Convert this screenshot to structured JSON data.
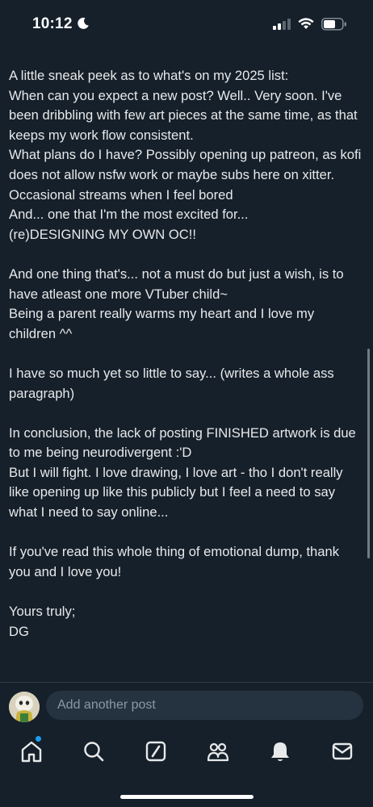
{
  "status_bar": {
    "time": "10:12"
  },
  "post": {
    "paragraphs": [
      "A little sneak peek as to what's on my 2025 list:\nWhen can you expect a new post? Well.. Very soon. I've been dribbling with few art pieces at the same time, as that keeps my work flow consistent.\nWhat plans do I have? Possibly opening up patreon, as kofi does not allow nsfw work or maybe subs here on xitter.\nOccasional streams when I feel bored\nAnd... one that I'm the most excited for...\n(re)DESIGNING MY OWN OC!!",
      "And one thing that's... not a must do but just a wish, is to have atleast one more VTuber child~\nBeing a parent really warms my heart and I love my children ^^",
      "I have so much yet so little to say... (writes a whole ass paragraph)",
      "In conclusion, the lack of posting FINISHED artwork is due to me being neurodivergent :'D\nBut I will fight. I love drawing, I love art - tho I don't really like opening up like this publicly but I feel a need to say what I need to say online...",
      "If you've read this whole thing of emotional dump, thank you and I love you!",
      "Yours truly;\nDG"
    ]
  },
  "reply": {
    "placeholder": "Add another post"
  },
  "nav": {
    "items": [
      {
        "icon": "home-icon"
      },
      {
        "icon": "search-icon"
      },
      {
        "icon": "grok-icon"
      },
      {
        "icon": "communities-icon"
      },
      {
        "icon": "notifications-icon"
      },
      {
        "icon": "messages-icon"
      }
    ]
  },
  "colors": {
    "background": "#16202b",
    "text": "#e7e9ea",
    "accent": "#1d9bf0",
    "input_bg": "#253341",
    "placeholder": "#8b98a5"
  }
}
